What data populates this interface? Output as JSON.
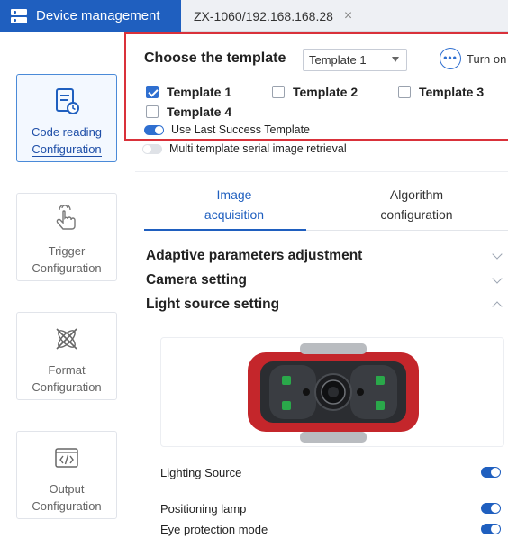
{
  "tabs": {
    "active_label": "Device management",
    "device_label": "ZX-1060/192.168.168.28",
    "close_glyph": "×"
  },
  "sidebar": {
    "items": [
      {
        "label_line1": "Code reading",
        "label_line2": "Configuration",
        "icon": "code-reading-icon",
        "active": true
      },
      {
        "label_line1": "Trigger",
        "label_line2": "Configuration",
        "icon": "hand-pointer-icon",
        "active": false
      },
      {
        "label_line1": "Format",
        "label_line2": "Configuration",
        "icon": "format-icon",
        "active": false
      },
      {
        "label_line1": "Output",
        "label_line2": "Configuration",
        "icon": "code-icon",
        "active": false
      }
    ]
  },
  "template": {
    "title": "Choose the template",
    "selected": "Template 1",
    "turn_on_label": "Turn on",
    "options": [
      {
        "label": "Template 1",
        "checked": true
      },
      {
        "label": "Template 2",
        "checked": false
      },
      {
        "label": "Template 3",
        "checked": false
      },
      {
        "label": "Template 4",
        "checked": false
      }
    ],
    "use_last_success": {
      "label": "Use Last Success Template",
      "on": true
    },
    "multi_template": {
      "label": "Multi template serial image retrieval",
      "on": false
    }
  },
  "subtabs": {
    "image_line1": "Image",
    "image_line2": "acquisition",
    "algo_line1": "Algorithm",
    "algo_line2": "configuration",
    "active": "image"
  },
  "sections": [
    {
      "label": "Adaptive parameters adjustment",
      "expanded": false
    },
    {
      "label": "Camera setting",
      "expanded": false
    },
    {
      "label": "Light source setting",
      "expanded": true
    }
  ],
  "light_settings": [
    {
      "label": "Lighting Source",
      "on": true
    },
    {
      "label": "Positioning lamp",
      "on": true
    },
    {
      "label": "Eye protection mode",
      "on": true
    }
  ],
  "colors": {
    "accent": "#1f5fbf",
    "highlight_border": "#d9313a",
    "device_body": "#c4262b"
  }
}
